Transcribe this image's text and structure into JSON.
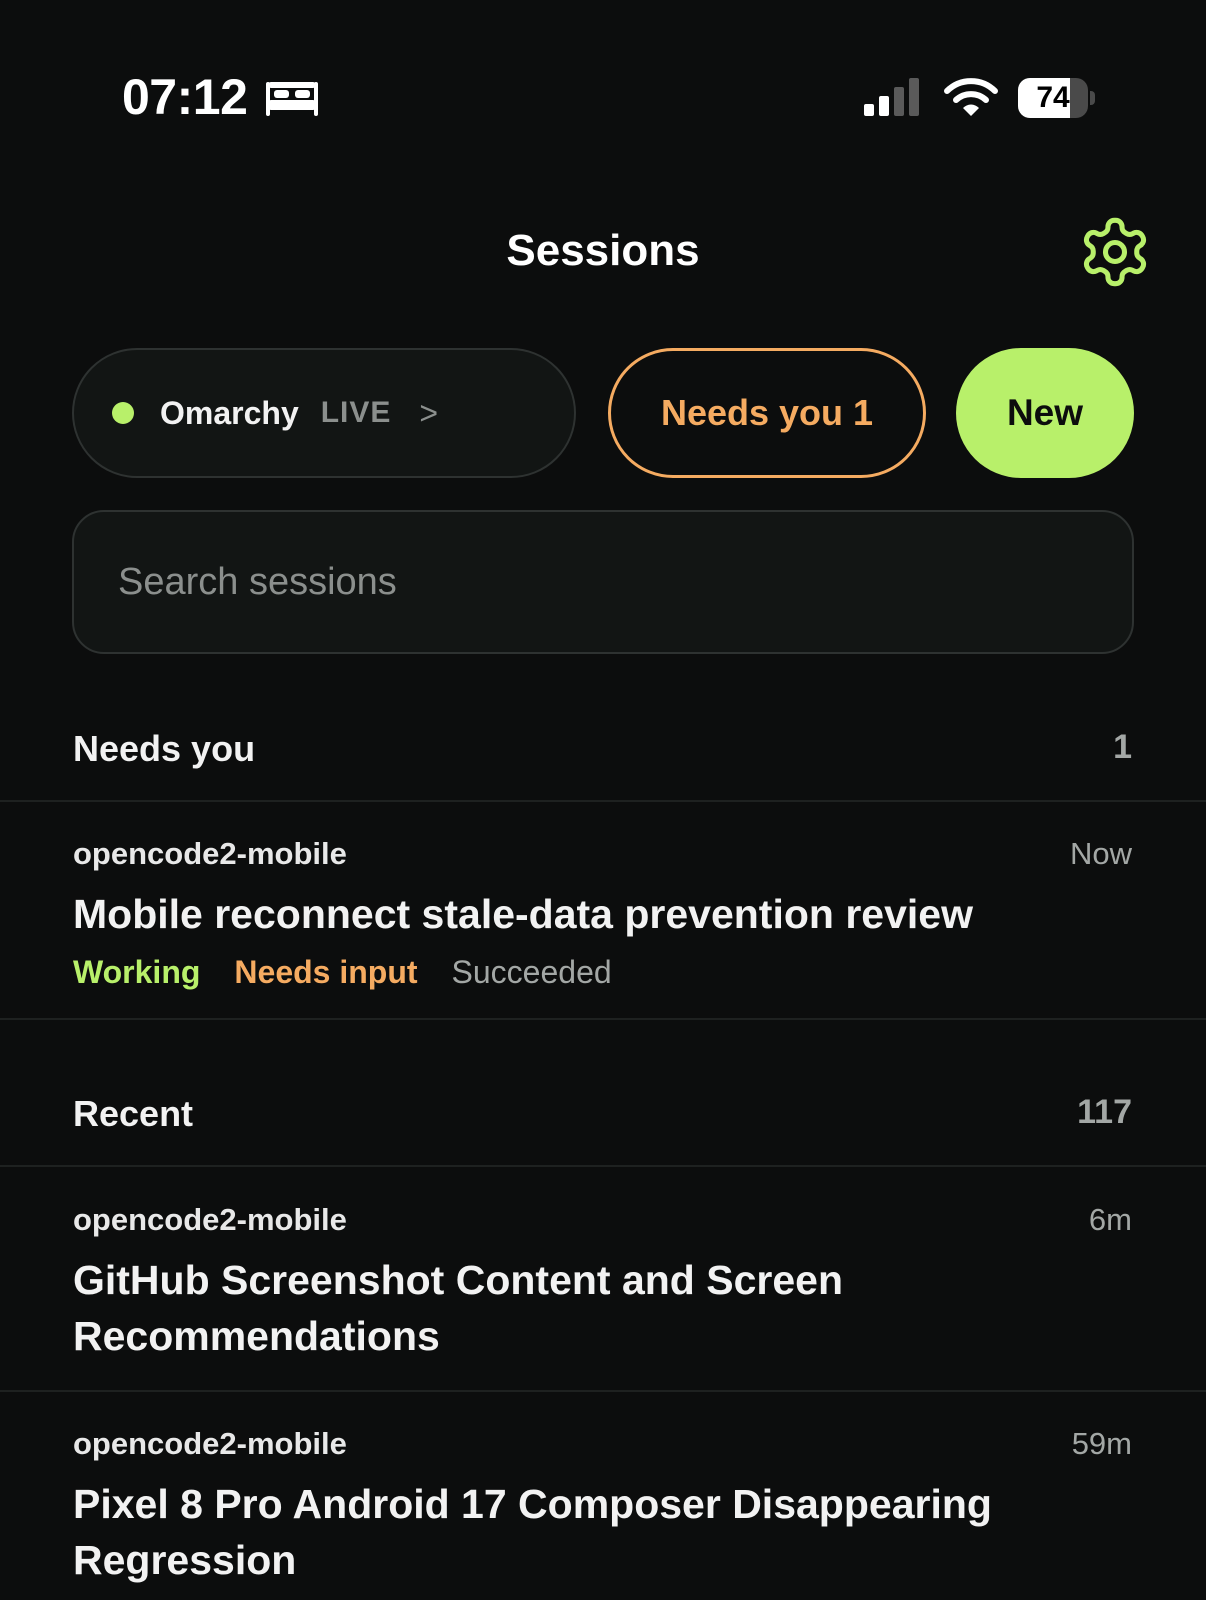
{
  "status_bar": {
    "time": "07:12",
    "battery_percent": "74",
    "battery_level": 0.74
  },
  "header": {
    "title": "Sessions",
    "settings_icon": "gear-icon"
  },
  "controls": {
    "server_name": "Omarchy",
    "server_status": "LIVE",
    "server_chevron": ">",
    "server_status_color": "#b8f06a",
    "needs_label": "Needs you 1",
    "new_label": "New"
  },
  "search": {
    "placeholder": "Search sessions",
    "value": ""
  },
  "needs_section": {
    "title": "Needs you",
    "count": "1",
    "items": [
      {
        "project": "opencode2-mobile",
        "time": "Now",
        "title": "Mobile reconnect stale-data prevention review",
        "statuses": {
          "working": "Working",
          "needs_input": "Needs input",
          "succeeded": "Succeeded"
        }
      }
    ]
  },
  "recent_section": {
    "title": "Recent",
    "count": "117",
    "items": [
      {
        "project": "opencode2-mobile",
        "time": "6m",
        "title_line1": "GitHub Screenshot Content and Screen",
        "title_line2": "Recommendations"
      },
      {
        "project": "opencode2-mobile",
        "time": "59m",
        "title_line1": "Pixel 8 Pro Android 17 Composer Disappearing",
        "title_line2": "Regression"
      }
    ]
  },
  "colors": {
    "background": "#0c0d0d",
    "accent_green": "#b8f06a",
    "accent_orange": "#f5ab61",
    "muted": "#a3a7a5"
  }
}
